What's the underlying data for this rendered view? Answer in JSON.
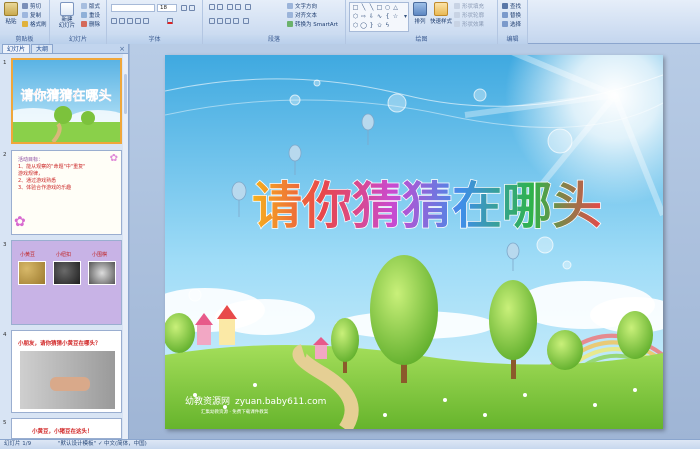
{
  "ribbon": {
    "clipboard": {
      "paste": "粘贴",
      "cut": "剪切",
      "copy": "复制",
      "format_painter": "格式刷",
      "label": "剪贴板"
    },
    "slides": {
      "new_slide": "新建\n幻灯片",
      "layout": "版式",
      "reset": "重设",
      "delete": "删除",
      "label": "幻灯片"
    },
    "font": {
      "size": "18",
      "label": "字体"
    },
    "paragraph": {
      "text_direction": "文字方向",
      "align_text": "对齐文本",
      "convert_smartart": "转换为 SmartArt",
      "label": "段落"
    },
    "drawing": {
      "arrange": "排列",
      "quick_styles": "快速样式",
      "shape_fill": "形状填充",
      "shape_outline": "形状轮廓",
      "shape_effects": "形状效果",
      "label": "绘图"
    },
    "editing": {
      "find": "查找",
      "replace": "替换",
      "select": "选择",
      "label": "编辑"
    }
  },
  "left_panel": {
    "tabs": [
      "幻灯片",
      "大纲"
    ],
    "close": "×",
    "slides": [
      {
        "num": "1",
        "title": "请你猜猜在哪头"
      },
      {
        "num": "2",
        "lines": [
          "活动目标：",
          "1、能从观察的\"命题\"中\"重复\"",
          "   游戏规律，",
          "2、通过游戏熟悉",
          "3、体验合作游戏的乐趣"
        ]
      },
      {
        "num": "3",
        "labels": [
          "小黄豆",
          "小纽扣",
          "小围棋"
        ]
      },
      {
        "num": "4",
        "title": "小朋友，请你猜猜小黄豆在哪头？"
      },
      {
        "num": "5",
        "title": "小黄豆，小猪豆在这头！"
      }
    ]
  },
  "slide": {
    "title": "请你猜猜在哪头",
    "watermark_cn": "幼教资源网",
    "watermark_url": "zyuan.baby611.com",
    "watermark_sub": "汇集幼教资源 · 免费下载课件教案"
  },
  "status": {
    "slide_info": "幻灯片 1/9",
    "theme": "\"默认设计模板\"",
    "language": "中文(简体，中国)"
  },
  "colors": {
    "ribbon_bg": "#d2e0f3",
    "selected_border": "#f0a73a",
    "sky_top": "#5ab3e4",
    "grass": "#8ad04a"
  }
}
